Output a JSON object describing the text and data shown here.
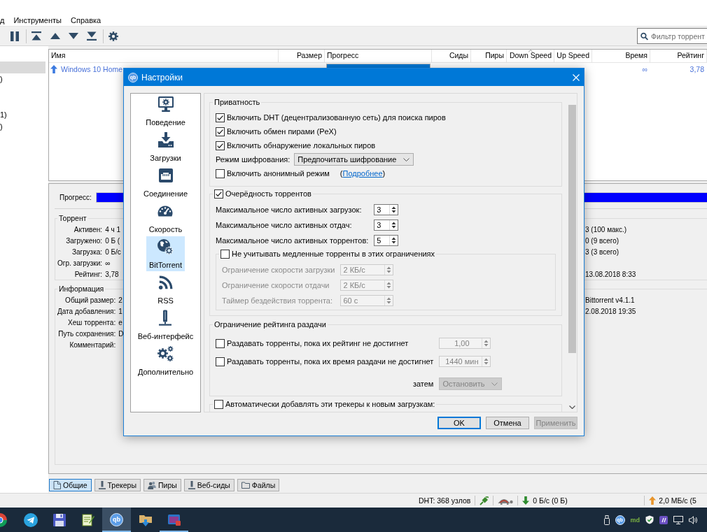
{
  "menu": [
    {
      "label": "д"
    },
    {
      "label": "Инструменты"
    },
    {
      "label": "Справка"
    }
  ],
  "search": {
    "placeholder": "Фильтр торрент"
  },
  "sidebar": {
    "items": [
      {
        "selected": true
      },
      {
        "label": ")",
        "selected": false
      },
      {
        "selected": false
      },
      {
        "selected": false
      },
      {
        "label": "1)",
        "selected": false
      },
      {
        "label": ")",
        "selected": false
      }
    ]
  },
  "table": {
    "columns": [
      {
        "label": "Имя",
        "sorted": false
      },
      {
        "label": "Размер",
        "sorted": false
      },
      {
        "label": "Прогресс",
        "sorted": false
      },
      {
        "label": "Сиды",
        "sorted": false
      },
      {
        "label": "Пиры",
        "sorted": false
      },
      {
        "label": "Down Speed",
        "sorted": true
      },
      {
        "label": "Up Speed",
        "sorted": false
      },
      {
        "label": "Время",
        "sorted": false
      },
      {
        "label": "Рейтинг",
        "sorted": false
      }
    ],
    "rows": [
      {
        "name": "Windows 10 Home",
        "level": 1,
        "time": "∞",
        "rating": "3,78"
      }
    ]
  },
  "properties": {
    "progress_label": "Прогресс:",
    "level": 1,
    "groups": [
      {
        "title": "Торрент",
        "rows": [
          {
            "label": "Активен:",
            "value": "4 ч 1",
            "column_3": "3 (100 макс.)"
          },
          {
            "label": "Загружено:",
            "value": "0 Б (",
            "column_3": "0 (9 всего)"
          },
          {
            "label": "Загрузка:",
            "value": "0 Б/с",
            "column_3": "3 (3 всего)"
          },
          {
            "label": "Огр. загрузки:",
            "value": "∞"
          },
          {
            "label": "Рейтинг:",
            "value": "3,78",
            "column_3": "13.08.2018 8:33"
          }
        ]
      },
      {
        "title": "Информация",
        "rows": [
          {
            "label": "Общий размер:",
            "value": "2",
            "column_3": "Bittorrent v4.1.1"
          },
          {
            "label": "Дата добавления:",
            "value": "1",
            "column_3": "2.08.2018 19:35"
          },
          {
            "label": "Хеш торрента:",
            "value": "e"
          },
          {
            "label": "Путь сохранения:",
            "value": "D"
          },
          {
            "label": "Комментарий:"
          }
        ]
      }
    ]
  },
  "bottom_tabs": [
    {
      "label": "Общие",
      "selected": true
    },
    {
      "label": "Трекеры",
      "selected": false
    },
    {
      "label": "Пиры",
      "selected": false
    },
    {
      "label": "Веб-сиды",
      "selected": false
    },
    {
      "label": "Файлы",
      "selected": false
    }
  ],
  "status_bar": {
    "dht": "DHT: 368 узлов",
    "download": "0 Б/с (0 Б)",
    "upload": "2,0 МБ/с (5"
  },
  "taskbar": {
    "apps": [
      {
        "selected": false,
        "running": false
      },
      {
        "selected": false,
        "running": false
      },
      {
        "selected": false,
        "running": false
      },
      {
        "selected": false,
        "running": false
      },
      {
        "logo": "qb",
        "selected": true,
        "running": true
      },
      {
        "selected": false,
        "running": false
      },
      {
        "selected": false,
        "running": true
      }
    ],
    "tray_logo": "qb",
    "tray_label": "md"
  },
  "dialog": {
    "logo": "qb",
    "title": "Настройки",
    "categories": [
      {
        "label": "Поведение",
        "selected": false
      },
      {
        "label": "Загрузки",
        "selected": false
      },
      {
        "label": "Соединение",
        "selected": false
      },
      {
        "label": "Скорость",
        "selected": false
      },
      {
        "label": "BitTorrent",
        "selected": true
      },
      {
        "label": "RSS",
        "selected": false
      },
      {
        "label": "Веб-интерфейс",
        "selected": false
      },
      {
        "label": "Дополнительно",
        "selected": false
      }
    ],
    "privacy": {
      "title": "Приватность",
      "checks": [
        {
          "label": "Включить DHT (децентрализованную сеть) для поиска пиров",
          "checked": true
        },
        {
          "label": "Включить обмен пирами (PeX)",
          "checked": true
        },
        {
          "label": "Включить обнаружение локальных пиров",
          "checked": true
        }
      ],
      "encryption": {
        "label": "Режим шифрования:",
        "value": "Предпочитать шифрование"
      },
      "anonymous": {
        "label": "Включить анонимный режим",
        "checked": false,
        "link_before": "(",
        "link": "Подробнее",
        "link_after": ")"
      }
    },
    "queueing": {
      "title": "Очерёдность торрентов",
      "checked": true,
      "limits": [
        {
          "label": "Максимальное число активных загрузок:",
          "value": "3"
        },
        {
          "label": "Максимальное число активных отдач:",
          "value": "3"
        },
        {
          "label": "Максимальное число активных торрентов:",
          "value": "5"
        }
      ],
      "slow": {
        "title": "Не учитывать медленные торренты в этих ограничениях",
        "checked": false,
        "rows": [
          {
            "label": "Ограничение скорости загрузки",
            "value": "2 КБ/с"
          },
          {
            "label": "Ограничение скорости отдачи",
            "value": "2 КБ/с"
          },
          {
            "label": "Таймер бездействия торрента:",
            "value": "60 с"
          }
        ]
      }
    },
    "seeding": {
      "title": "Ограничение рейтинга раздачи",
      "rows": [
        {
          "label": "Раздавать торренты, пока их рейтинг не достигнет",
          "checked": false,
          "value": "1,00"
        },
        {
          "label": "Раздавать торренты, пока их время раздачи не достигнет",
          "checked": false,
          "value": "1440 мин"
        }
      ],
      "then": {
        "label": "затем",
        "value": "Остановить"
      }
    },
    "trackers": {
      "label": "Автоматически добавлять эти трекеры к новым загрузкам:",
      "checked": false
    },
    "buttons": [
      {
        "label": "OK",
        "default": true,
        "disabled": false
      },
      {
        "label": "Отмена",
        "default": false,
        "disabled": false
      },
      {
        "label": "Применить",
        "default": false,
        "disabled": true
      }
    ]
  }
}
